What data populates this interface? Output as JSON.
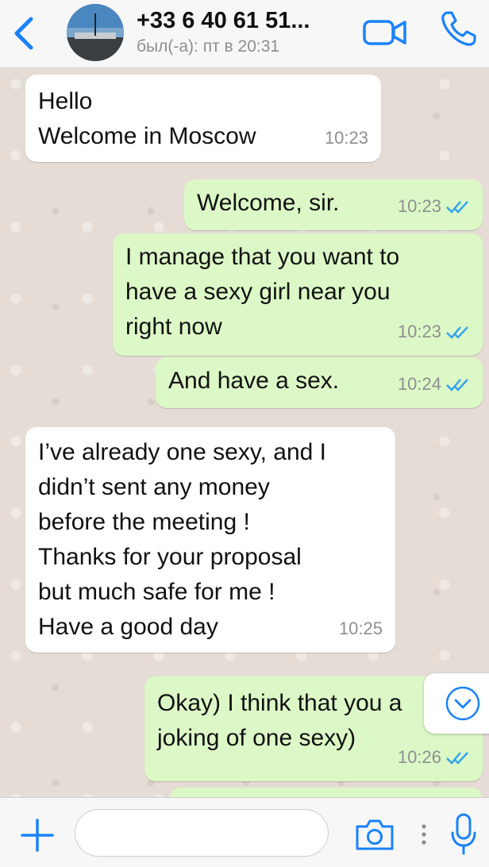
{
  "header": {
    "contact_name": "+33 6 40 61 51...",
    "status": "был(-а): пт в 20:31"
  },
  "messages": [
    {
      "direction": "in",
      "text": "Hello\nWelcome in Moscow",
      "time": "10:23"
    },
    {
      "direction": "out",
      "text": "Welcome, sir.",
      "time": "10:23",
      "read": true
    },
    {
      "direction": "out",
      "text": "I manage that you want to\nhave a sexy girl near you\nright now",
      "time": "10:23",
      "read": true
    },
    {
      "direction": "out",
      "text": "And have a sex.",
      "time": "10:24",
      "read": true
    },
    {
      "direction": "in",
      "text": "I’ve already one sexy, and I\ndidn’t sent any money\nbefore the meeting !\nThanks for your proposal\nbut much safe for me !\nHave a good day",
      "time": "10:25"
    },
    {
      "direction": "out",
      "text": "Okay) I think that you a\njoking of one sexy)",
      "time": "10:26",
      "read": true
    }
  ],
  "composer": {
    "value": "",
    "placeholder": ""
  },
  "colors": {
    "accent": "#1a82fb",
    "bubble_out": "#dcf8c6",
    "bubble_in": "#ffffff",
    "read_ticks": "#34a4f0"
  },
  "icons": [
    "back-chevron-icon",
    "video-camera-icon",
    "phone-icon",
    "plus-icon",
    "camera-icon",
    "mic-icon",
    "chevron-down-icon"
  ]
}
